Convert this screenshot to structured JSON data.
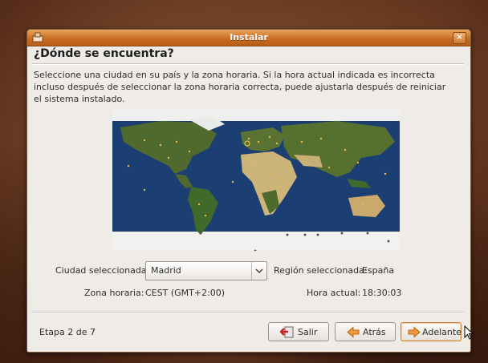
{
  "window": {
    "title": "Instalar",
    "close_symbol": "×"
  },
  "page": {
    "heading": "¿Dónde se encuentra?",
    "instructions": "Seleccione una ciudad en su país y la zona horaria. Si la hora actual indicada es incorrecta incluso después de seleccionar la zona horaria correcta, puede ajustarla después de reiniciar el sistema instalado."
  },
  "location": {
    "city_label": "Ciudad seleccionada:",
    "city_value": "Madrid",
    "region_label": "Región seleccionada:",
    "region_value": "España",
    "timezone_label": "Zona horaria:",
    "timezone_value": "CEST (GMT+2:00)",
    "time_label": "Hora actual:",
    "time_value": "18:30:03"
  },
  "footer": {
    "step": "Etapa 2 de 7",
    "quit_label": "Salir",
    "back_label": "Atrás",
    "forward_label": "Adelante"
  },
  "colors": {
    "titlebar": "#c76a1f",
    "ocean": "#1b3f73",
    "land": "#4f6a2c",
    "desert": "#cdb57a",
    "ice": "#f2f2f0",
    "city_dot": "#e8b84a"
  },
  "icons": {
    "app": "installer-icon",
    "close": "close-icon",
    "combo": "chevron-down-icon",
    "quit": "exit-icon",
    "back": "arrow-left-icon",
    "forward": "arrow-right-icon"
  }
}
